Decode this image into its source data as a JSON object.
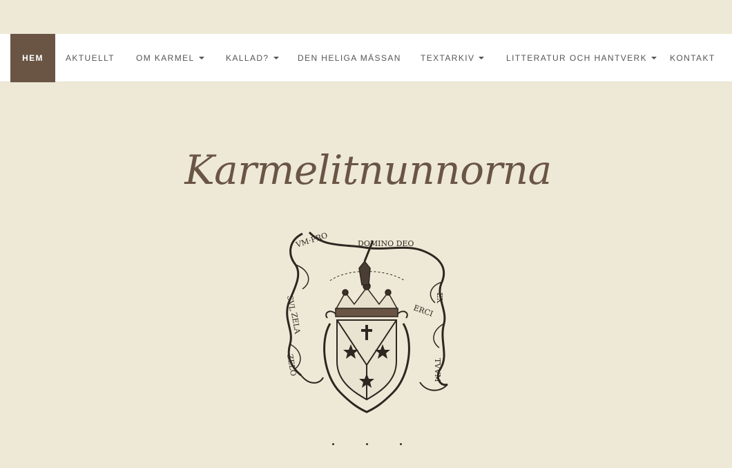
{
  "nav": {
    "items": [
      {
        "label": "HEM",
        "active": true,
        "dropdown": false
      },
      {
        "label": "AKTUELLT",
        "active": false,
        "dropdown": false
      },
      {
        "label": "OM KARMEL",
        "active": false,
        "dropdown": true
      },
      {
        "label": "KALLAD?",
        "active": false,
        "dropdown": true
      },
      {
        "label": "DEN HELIGA MÄSSAN",
        "active": false,
        "dropdown": false
      },
      {
        "label": "TEXTARKIV",
        "active": false,
        "dropdown": true
      },
      {
        "label": "LITTERATUR OCH HANTVERK",
        "active": false,
        "dropdown": true
      },
      {
        "label": "KONTAKT",
        "active": false,
        "dropdown": false
      }
    ]
  },
  "hero": {
    "title": "Karmelitnunnorna",
    "emblem_icon": "carmelite-coat-of-arms",
    "emblem_motto": "ZELO ZELATUS SUM PRO DOMINO DEO EXERCITUUM",
    "slide_count": 3
  },
  "colors": {
    "background": "#ede9d6",
    "navbar": "#ffffff",
    "accent": "#6a5545",
    "nav_text": "#555555"
  }
}
